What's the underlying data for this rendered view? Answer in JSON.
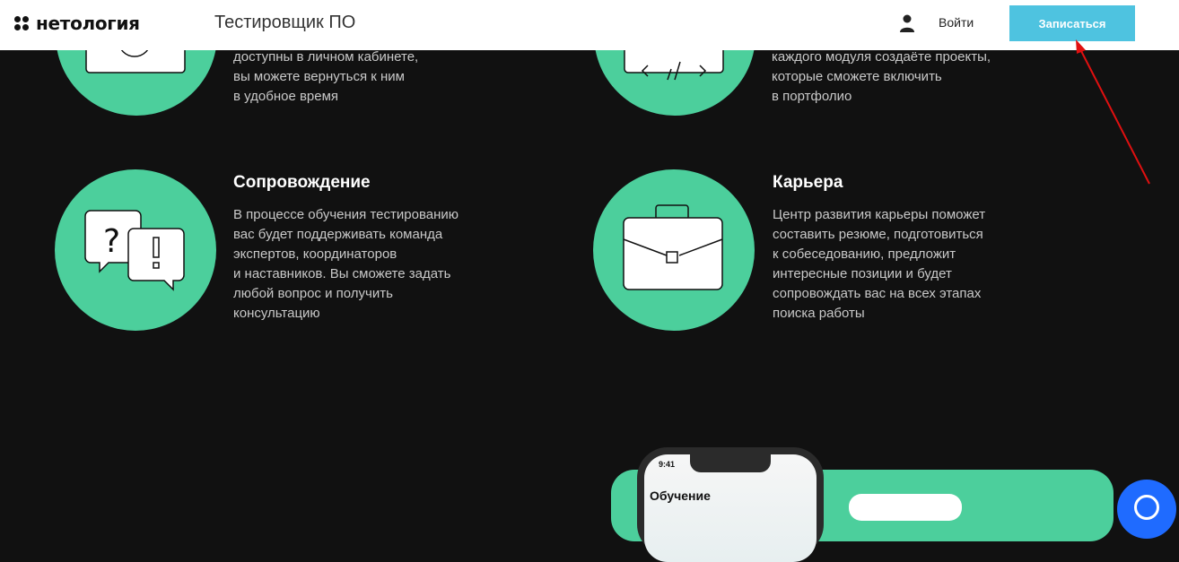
{
  "header": {
    "logo_text": "нетология",
    "course_title": "Тестировщик ПО",
    "login_label": "Войти",
    "signup_label": "Записаться"
  },
  "features": {
    "top_left_desc": "доступны в личном кабинете,\nвы можете вернуться к ним\nв удобное время",
    "top_right_desc": "каждого модуля создаёте проекты,\nкоторые сможете включить\nв портфолио",
    "support": {
      "title": "Сопровождение",
      "desc": "В процессе обучения тестированию\nвас будет поддерживать команда\nэкспертов, координаторов\nи наставников. Вы сможете задать\nлюбой вопрос и получить\nконсультацию"
    },
    "career": {
      "title": "Карьера",
      "desc": "Центр развития карьеры поможет\nсоставить резюме, подготовиться\nк собеседованию, предложит\nинтересные позиции и будет\nсопровождать вас на всех этапах\nпоиска работы"
    }
  },
  "phone": {
    "time": "9:41",
    "heading": "Обучение"
  },
  "colors": {
    "background": "#111111",
    "accent_green": "#4ccf9c",
    "signup_button": "#4ec3e0",
    "chat_button": "#1f6bff",
    "annotation_arrow": "#e01010"
  },
  "icons": [
    "user-icon",
    "question-bubble-icon",
    "exclamation-bubble-icon",
    "briefcase-icon",
    "chat-icon"
  ]
}
